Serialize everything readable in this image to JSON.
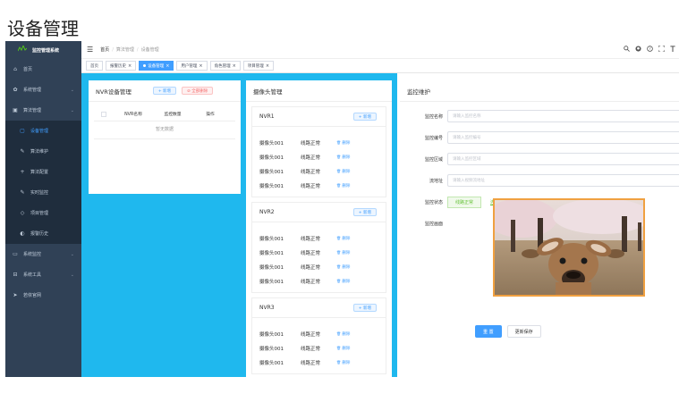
{
  "page_heading": "设备管理",
  "app": {
    "title": "监控管理系统"
  },
  "sidebar": {
    "items": [
      {
        "label": "首页",
        "icon": "home-icon",
        "glyph": "⌂",
        "level": 0,
        "active": false,
        "arrow": false
      },
      {
        "label": "系统管理",
        "icon": "gear-icon",
        "glyph": "✿",
        "level": 0,
        "active": false,
        "arrow": true
      },
      {
        "label": "算法管理",
        "icon": "algorithm-icon",
        "glyph": "▣",
        "level": 0,
        "active": false,
        "arrow": true
      },
      {
        "label": "设备管理",
        "icon": "device-icon",
        "glyph": "▢",
        "level": 1,
        "active": true,
        "arrow": false
      },
      {
        "label": "算法维护",
        "icon": "edit-icon",
        "glyph": "✎",
        "level": 1,
        "active": false,
        "arrow": false
      },
      {
        "label": "算法配置",
        "icon": "plus-icon",
        "glyph": "+",
        "level": 1,
        "active": false,
        "arrow": false
      },
      {
        "label": "实时监控",
        "icon": "monitor-edit-icon",
        "glyph": "✎",
        "level": 1,
        "active": false,
        "arrow": false
      },
      {
        "label": "项目管理",
        "icon": "project-icon",
        "glyph": "◇",
        "level": 1,
        "active": false,
        "arrow": false
      },
      {
        "label": "报警历史",
        "icon": "alarm-icon",
        "glyph": "◐",
        "level": 1,
        "active": false,
        "arrow": false
      },
      {
        "label": "系统监控",
        "icon": "system-monitor-icon",
        "glyph": "▭",
        "level": 0,
        "active": false,
        "arrow": true
      },
      {
        "label": "系统工具",
        "icon": "tools-icon",
        "glyph": "⊟",
        "level": 0,
        "active": false,
        "arrow": true
      },
      {
        "label": "若依官网",
        "icon": "send-icon",
        "glyph": "➤",
        "level": 0,
        "active": false,
        "arrow": false
      }
    ]
  },
  "breadcrumb": [
    "首页",
    "算法管理",
    "设备管理"
  ],
  "tags": [
    {
      "label": "首页",
      "active": false,
      "closable": false
    },
    {
      "label": "报警历史",
      "active": false,
      "closable": true
    },
    {
      "label": "设备管理",
      "active": true,
      "closable": true
    },
    {
      "label": "用户管理",
      "active": false,
      "closable": true
    },
    {
      "label": "角色管理",
      "active": false,
      "closable": true
    },
    {
      "label": "项目管理",
      "active": false,
      "closable": true
    }
  ],
  "nvr_panel": {
    "title": "NVR设备管理",
    "add_label": "+ 新增",
    "delete_all_label": "⊘ 全部删除",
    "columns": [
      "NVR名称",
      "监控数量",
      "操作"
    ],
    "empty_text": "暂无数据"
  },
  "camera_panel": {
    "title": "摄像头管理",
    "add_label": "+ 新增",
    "delete_label": "删除",
    "groups": [
      {
        "name": "NVR1",
        "cameras": [
          {
            "name": "摄像头001",
            "status": "线路正常"
          },
          {
            "name": "摄像头001",
            "status": "线路正常"
          },
          {
            "name": "摄像头001",
            "status": "线路正常"
          },
          {
            "name": "摄像头001",
            "status": "线路正常"
          }
        ]
      },
      {
        "name": "NVR2",
        "cameras": [
          {
            "name": "摄像头001",
            "status": "线路正常"
          },
          {
            "name": "摄像头001",
            "status": "线路正常"
          },
          {
            "name": "摄像头001",
            "status": "线路正常"
          },
          {
            "name": "摄像头001",
            "status": "线路正常"
          }
        ]
      },
      {
        "name": "NVR3",
        "cameras": [
          {
            "name": "摄像头001",
            "status": "线路正常"
          },
          {
            "name": "摄像头001",
            "status": "线路正常"
          },
          {
            "name": "摄像头001",
            "status": "线路正常"
          }
        ]
      }
    ]
  },
  "monitor_panel": {
    "title": "监控维护",
    "fields": [
      {
        "label": "监控名称",
        "placeholder": "请输入监控名称"
      },
      {
        "label": "监控编号",
        "placeholder": "请输入监控编号"
      },
      {
        "label": "监控区域",
        "placeholder": "请输入监控区域"
      },
      {
        "label": "流地址",
        "placeholder": "请输入视频流地址"
      }
    ],
    "status_label": "监控状态",
    "status_value": "线路正常",
    "status_link": "连接测试",
    "image_label": "监控画面",
    "reset_label": "重 置",
    "save_label": "更新保存"
  },
  "colors": {
    "sidebar_bg": "#304156",
    "accent": "#409eff",
    "content_blue": "#1fb8ee",
    "success": "#67c23a",
    "danger": "#f56c6c"
  }
}
